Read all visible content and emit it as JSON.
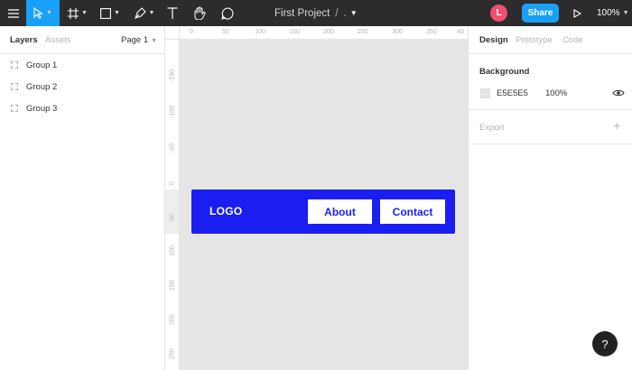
{
  "toolbar": {
    "project_title": "First Project",
    "separator": "/",
    "page_indicator": ".",
    "avatar_initial": "L",
    "share_label": "Share",
    "zoom": "100%"
  },
  "left_panel": {
    "tabs": [
      {
        "label": "Layers"
      },
      {
        "label": "Assets"
      }
    ],
    "page_selector": "Page 1",
    "layers": [
      {
        "label": "Group 1"
      },
      {
        "label": "Group 2"
      },
      {
        "label": "Group 3"
      }
    ]
  },
  "rulers": {
    "top": [
      "0",
      "50",
      "100",
      "150",
      "200",
      "250",
      "300",
      "350",
      "40"
    ],
    "left": [
      "-150",
      "-100",
      "-50",
      "0",
      "50",
      "100",
      "150",
      "200",
      "250"
    ]
  },
  "canvas": {
    "logo": "LOGO",
    "buttons": [
      {
        "label": "About"
      },
      {
        "label": "Contact"
      }
    ],
    "nav_color": "#1b1ef0",
    "background": "#e5e5e5"
  },
  "right_panel": {
    "tabs": [
      {
        "label": "Design"
      },
      {
        "label": "Prototype"
      },
      {
        "label": "Code"
      }
    ],
    "background_title": "Background",
    "background_hex": "E5E5E5",
    "background_opacity": "100%",
    "export_title": "Export"
  },
  "help_label": "?"
}
